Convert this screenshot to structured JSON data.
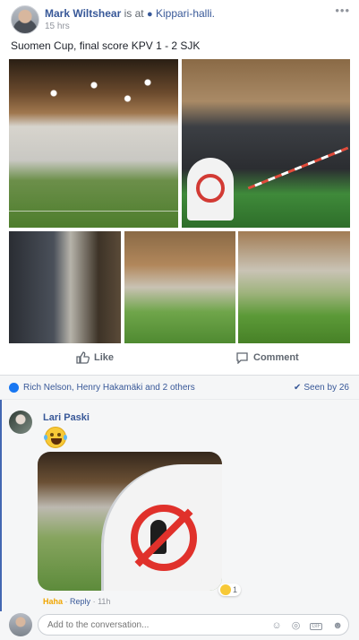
{
  "post": {
    "author": "Mark Wiltshear",
    "checkin_text": "is at",
    "location": "Kippari-halli.",
    "time": "15 hrs",
    "text": "Suomen Cup, final score KPV 1 - 2 SJK",
    "photos": [
      {
        "name": "indoor-football-hall-photo"
      },
      {
        "name": "spectators-photo"
      },
      {
        "name": "spectator-crowd-photo"
      },
      {
        "name": "match-action-photo"
      },
      {
        "name": "players-photo"
      }
    ]
  },
  "actions": {
    "like": "Like",
    "comment": "Comment"
  },
  "reactions": {
    "summary": "Rich Nelson, Henry Hakamäki and 2 others",
    "seen": "Seen by 26"
  },
  "comment": {
    "author": "Lari Paski",
    "reaction_count": "1",
    "reaction_label": "Haha",
    "reply_label": "Reply",
    "separator": "·",
    "age": "11h"
  },
  "composer": {
    "placeholder": "Add to the conversation..."
  },
  "colors": {
    "link": "#385898",
    "like_blue": "#1877f2",
    "haha": "#f0a500"
  }
}
